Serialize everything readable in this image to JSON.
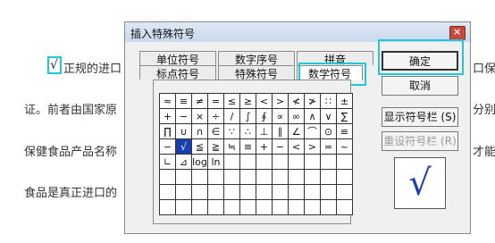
{
  "document": {
    "line1_before": "√",
    "line1": "正规的进口",
    "line1_right": "口保",
    "line2": "证。前者由国家原",
    "line2_right": "分别",
    "line3": "保健食品产品名称",
    "line3_right": "才能",
    "line4": "食品是真正进口的"
  },
  "dialog": {
    "title": "插入特殊符号",
    "close_label": "×",
    "tabs": {
      "unit": "单位符号",
      "number_seq": "数字序号",
      "pinyin": "拼音",
      "punct": "标点符号",
      "special": "特殊符号",
      "math": "数学符号"
    },
    "buttons": {
      "ok": "确定",
      "cancel": "取消",
      "show_bar": "显示符号栏 (S)",
      "reset_bar": "重设符号栏 (R)"
    },
    "preview_symbol": "√",
    "symbols": [
      [
        "≈",
        "≡",
        "≠",
        "=",
        "≤",
        "≥",
        "<",
        ">",
        "≮",
        "≯",
        "∷",
        "±"
      ],
      [
        "+",
        "−",
        "×",
        "÷",
        "/",
        "∫",
        "∮",
        "∝",
        "∞",
        "∧",
        "∨",
        "∑"
      ],
      [
        "∏",
        "∪",
        "∩",
        "∈",
        "∵",
        "∴",
        "⊥",
        "∥",
        "∠",
        "⌒",
        "⊙",
        "≌"
      ],
      [
        "∽",
        "√",
        "≦",
        "≧",
        "≒",
        "≡",
        "+",
        "−",
        "<",
        ">",
        "=",
        "~"
      ],
      [
        "∟",
        "⊿",
        "log",
        "ln",
        "",
        "",
        "",
        "",
        "",
        "",
        "",
        ""
      ],
      [
        "",
        "",
        "",
        "",
        "",
        "",
        "",
        "",
        "",
        "",
        "",
        ""
      ],
      [
        "",
        "",
        "",
        "",
        "",
        "",
        "",
        "",
        "",
        "",
        "",
        ""
      ],
      [
        "",
        "",
        "",
        "",
        "",
        "",
        "",
        "",
        "",
        "",
        "",
        ""
      ]
    ],
    "selected_index": 37
  }
}
